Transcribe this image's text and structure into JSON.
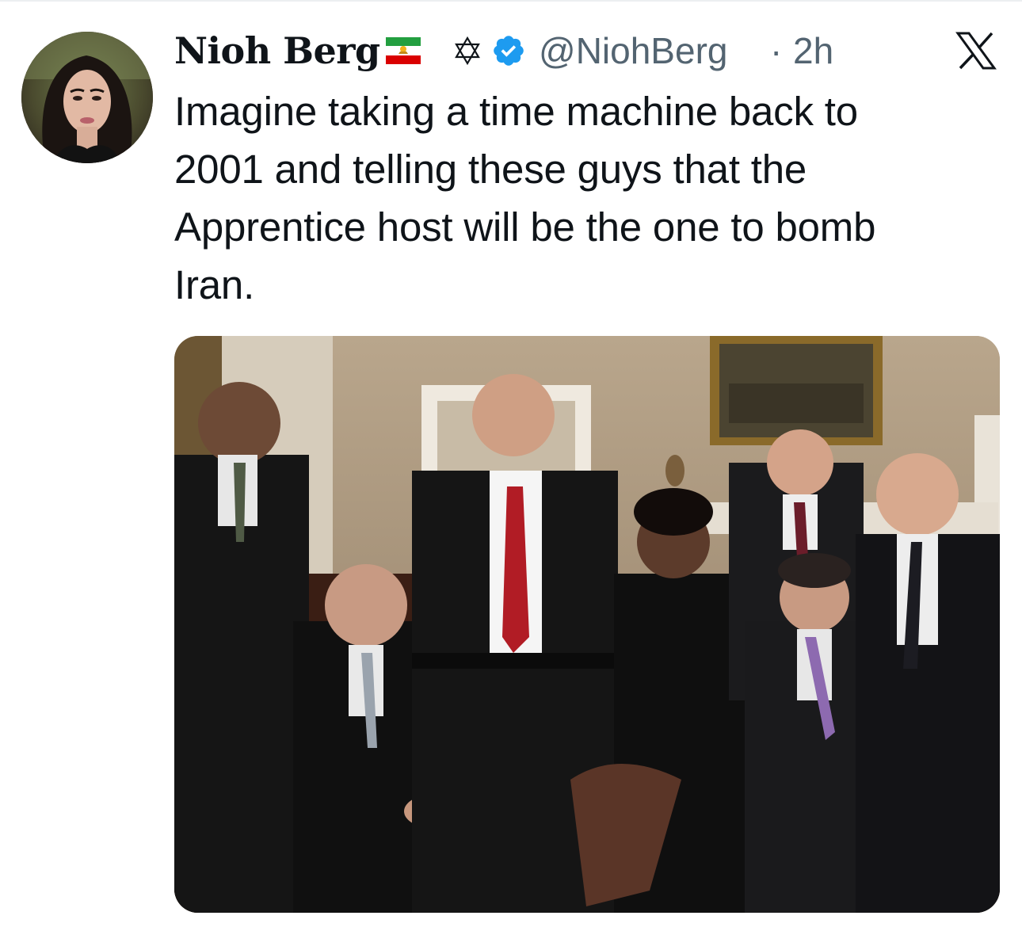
{
  "tweet": {
    "author": {
      "display_name": "Nioh Berg",
      "handle": "@NiohBerg",
      "flag_icon": "iran-lion-and-sun-flag-icon",
      "symbol_icon": "star-of-david-icon",
      "verified_icon": "verified-badge-icon",
      "verified_color": "#1d9bf0",
      "avatar_icon": "profile-avatar"
    },
    "separator": "·",
    "timestamp": "2h",
    "platform_logo": "x-logo-icon",
    "text_lines": [
      "Imagine taking a time machine back to",
      "2001 and telling these guys that the",
      "Apprentice host will be the one to bomb",
      "Iran."
    ],
    "media": {
      "type": "photo",
      "icon": "group-photo-image"
    }
  },
  "colors": {
    "text_primary": "#0f1419",
    "text_secondary": "#536471",
    "background": "#ffffff"
  }
}
